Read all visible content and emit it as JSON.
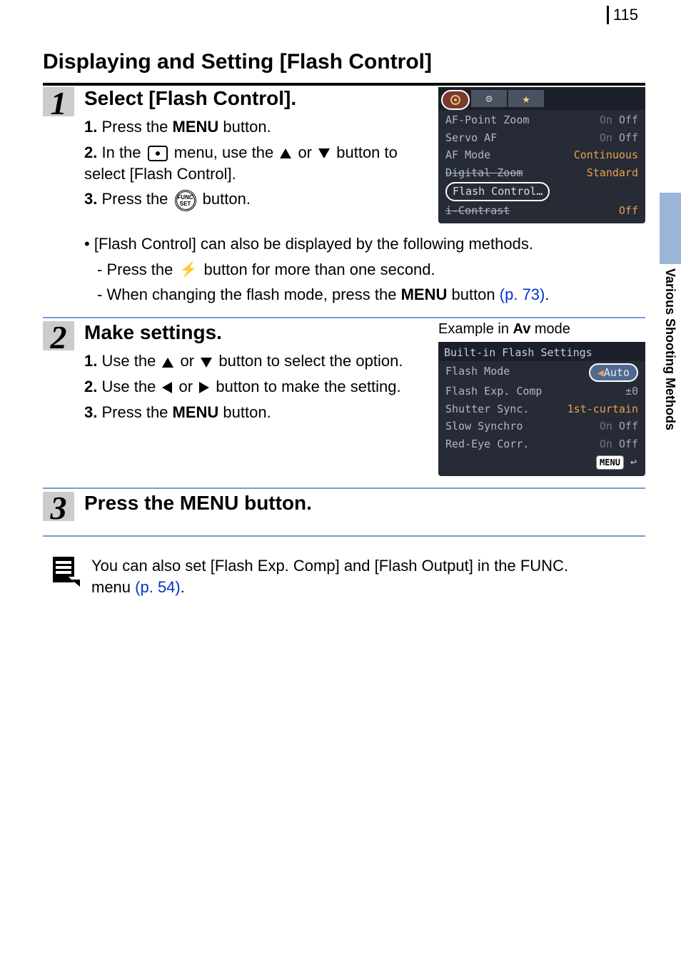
{
  "page_number": "115",
  "side_tab_label": "Various Shooting Methods",
  "h1": "Displaying and Setting [Flash Control]",
  "step1": {
    "num": "1",
    "title": "Select [Flash Control].",
    "li1_pre": "1.",
    "li1_a": "Press the ",
    "li1_b": "MENU",
    "li1_c": " button.",
    "li2_pre": "2.",
    "li2_a": "In the ",
    "li2_b": " menu, use the ",
    "li2_c": " or ",
    "li2_d": " button to select [Flash Control].",
    "li3_pre": "3.",
    "li3_a": "Press the ",
    "li3_b": " button.",
    "bullet_a": "[Flash Control] can also be displayed by the following methods.",
    "dash1_a": "Press the ",
    "dash1_b": " button for more than one second.",
    "dash2_a": "When changing the flash mode, press the ",
    "dash2_b": "MENU",
    "dash2_c": " button ",
    "dash2_link": "(p. 73)",
    "dash2_d": "."
  },
  "step2": {
    "num": "2",
    "title": "Make settings.",
    "example": "Example in ",
    "example_mode": "Av",
    "example_suffix": " mode",
    "li1_pre": "1.",
    "li1_a": "Use the ",
    "li1_b": " or ",
    "li1_c": " button to select the option.",
    "li2_pre": "2.",
    "li2_a": "Use the ",
    "li2_b": " or ",
    "li2_c": " button to make the setting.",
    "li3_pre": "3.",
    "li3_a": "Press the ",
    "li3_b": "MENU",
    "li3_c": " button."
  },
  "step3": {
    "num": "3",
    "title_a": "Press the ",
    "title_b": "MENU",
    "title_c": " button."
  },
  "note": {
    "a": "You can also set [Flash Exp. Comp] and [Flash Output] in the FUNC. menu ",
    "link": "(p. 54)",
    "b": "."
  },
  "screen1": {
    "tab2": "⚙",
    "tab3": "★",
    "r1_label": "AF-Point Zoom",
    "r1_on": "On",
    "r1_val": "Off",
    "r2_label": "Servo AF",
    "r2_on": "On",
    "r2_val": "Off",
    "r3_label": "AF Mode",
    "r3_val": "Continuous",
    "r4_label": "Digital Zoom",
    "r4_val": "Standard",
    "r5_label": "Flash Control…",
    "r6_label": "i-Contrast",
    "r6_val": "Off"
  },
  "screen2": {
    "title": "Built-in Flash Settings",
    "r1_label": "Flash Mode",
    "r1_val": "Auto",
    "r2_label": "Flash Exp. Comp",
    "r2_val": "±0",
    "r3_label": "Shutter Sync.",
    "r3_val": "1st-curtain",
    "r4_label": "Slow Synchro",
    "r4_on": "On",
    "r4_val": "Off",
    "r5_label": "Red-Eye Corr.",
    "r5_on": "On",
    "r5_val": "Off",
    "menu": "MENU"
  },
  "funcset_label": "FUNC SET"
}
